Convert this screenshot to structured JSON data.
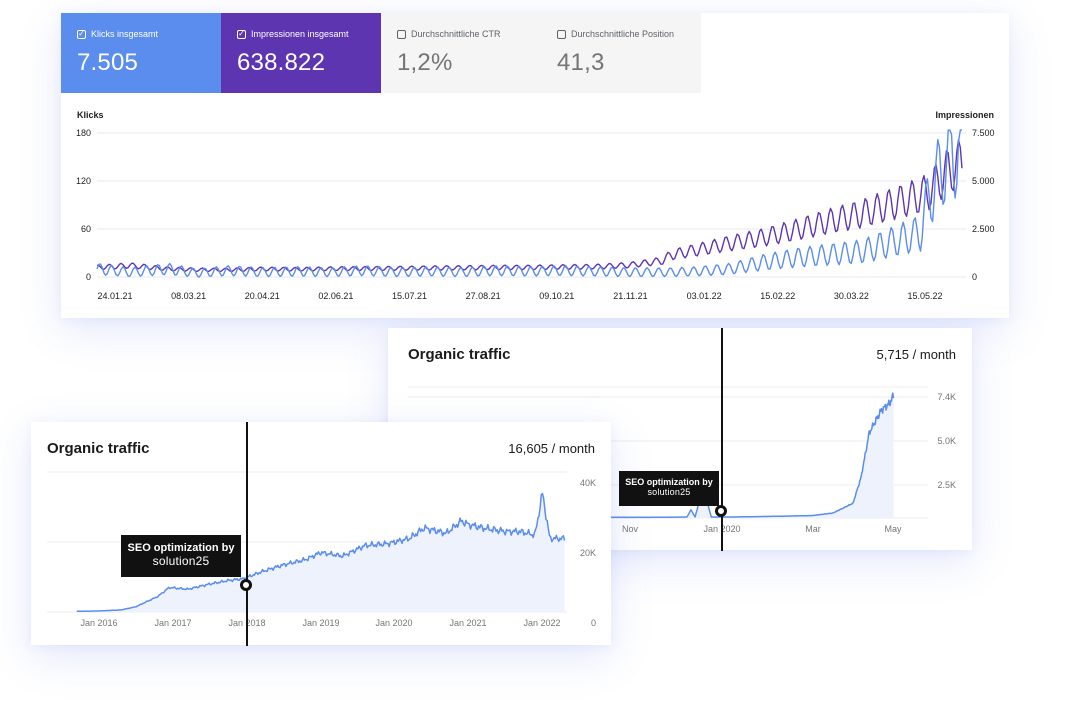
{
  "gsc": {
    "tiles": [
      {
        "label": "Klicks insgesamt",
        "value": "7.505",
        "checked": true,
        "check": "✓"
      },
      {
        "label": "Impressionen insgesamt",
        "value": "638.822",
        "checked": true,
        "check": "✓"
      },
      {
        "label": "Durchschnittliche CTR",
        "value": "1,2%",
        "checked": false,
        "check": ""
      },
      {
        "label": "Durchschnittliche Position",
        "value": "41,3",
        "checked": false,
        "check": ""
      }
    ]
  },
  "chart_data": [
    {
      "type": "line",
      "title": "",
      "xlabel": "",
      "ylabel_left": "Klicks",
      "ylabel_right": "Impressionen",
      "x_ticks": [
        "24.01.21",
        "08.03.21",
        "20.04.21",
        "02.06.21",
        "15.07.21",
        "27.08.21",
        "09.10.21",
        "21.11.21",
        "03.01.22",
        "15.02.22",
        "30.03.22",
        "15.05.22"
      ],
      "y_ticks_left": [
        "180",
        "120",
        "60",
        "0"
      ],
      "y_ticks_right": [
        "7.500",
        "5.000",
        "2.500",
        "0"
      ],
      "ylim_left": [
        0,
        180
      ],
      "ylim_right": [
        0,
        7500
      ],
      "grid": true,
      "x_days": [
        0,
        20,
        43,
        60,
        80,
        100,
        120,
        140,
        160,
        180,
        200,
        220,
        240,
        260,
        280,
        300,
        320,
        340,
        345,
        360,
        380,
        400,
        420,
        440,
        460,
        480,
        495,
        500,
        510,
        520
      ],
      "series": [
        {
          "name": "Klicks",
          "axis": "left",
          "color": "#5b8def",
          "values": [
            10,
            6,
            10,
            5,
            8,
            6,
            7,
            6,
            8,
            6,
            7,
            6,
            8,
            7,
            8,
            7,
            6,
            6,
            6,
            7,
            10,
            18,
            24,
            28,
            32,
            45,
            55,
            100,
            145,
            165
          ]
        },
        {
          "name": "Impressionen",
          "axis": "right",
          "color": "#5e35b1",
          "values": [
            500,
            600,
            420,
            380,
            370,
            420,
            400,
            430,
            440,
            450,
            470,
            480,
            500,
            500,
            520,
            540,
            620,
            850,
            1150,
            1400,
            1750,
            2050,
            2450,
            2900,
            3300,
            3850,
            4250,
            4450,
            5400,
            6000
          ]
        }
      ]
    },
    {
      "type": "area",
      "title": "Organic traffic",
      "value_label": "16,605 / month",
      "x_ticks": [
        "Jan 2016",
        "Jan 2017",
        "Jan 2018",
        "Jan 2019",
        "Jan 2020",
        "Jan 2021",
        "Jan 2022"
      ],
      "y_ticks": [
        "40K",
        "20K",
        "0"
      ],
      "ylim": [
        0,
        40000
      ],
      "x": [
        2015.7,
        2016.0,
        2016.3,
        2016.5,
        2016.8,
        2016.95,
        2017.2,
        2017.5,
        2017.75,
        2017.95,
        2018.2,
        2018.5,
        2018.8,
        2019.0,
        2019.3,
        2019.6,
        2019.9,
        2020.2,
        2020.4,
        2020.7,
        2020.9,
        2021.0,
        2021.2,
        2021.5,
        2021.7,
        2021.9,
        2022.0,
        2022.1,
        2022.3
      ],
      "values": [
        200,
        300,
        600,
        1500,
        4500,
        7000,
        6500,
        8000,
        9000,
        9500,
        11500,
        13500,
        15000,
        17000,
        16000,
        19000,
        19500,
        21000,
        24000,
        22500,
        26000,
        25000,
        24000,
        23000,
        23000,
        22000,
        34000,
        21000,
        21000
      ],
      "annotation": {
        "line1": "SEO optimization by",
        "line2": "solution25",
        "x": "Jan 2018"
      }
    },
    {
      "type": "area",
      "title": "Organic traffic",
      "value_label": "5,715 / month",
      "x_ticks": [
        "Nov",
        "Jan 2020",
        "Mar",
        "May"
      ],
      "y_ticks": [
        "7.4K",
        "5.0K",
        "2.5K"
      ],
      "ylim": [
        0,
        7400
      ],
      "x_months": [
        0,
        1.0,
        1.9,
        2.0,
        2.1,
        2.3,
        2.5,
        3,
        4,
        5,
        5.5,
        6.0,
        6.2,
        6.4,
        6.7,
        6.9,
        7.0
      ],
      "values": [
        40,
        40,
        60,
        500,
        60,
        1900,
        60,
        60,
        100,
        150,
        300,
        900,
        2500,
        5200,
        6600,
        7000,
        7500
      ],
      "annotation": {
        "line1": "SEO optimization by",
        "line2": "solution25",
        "x": "Jan 2020"
      }
    }
  ]
}
